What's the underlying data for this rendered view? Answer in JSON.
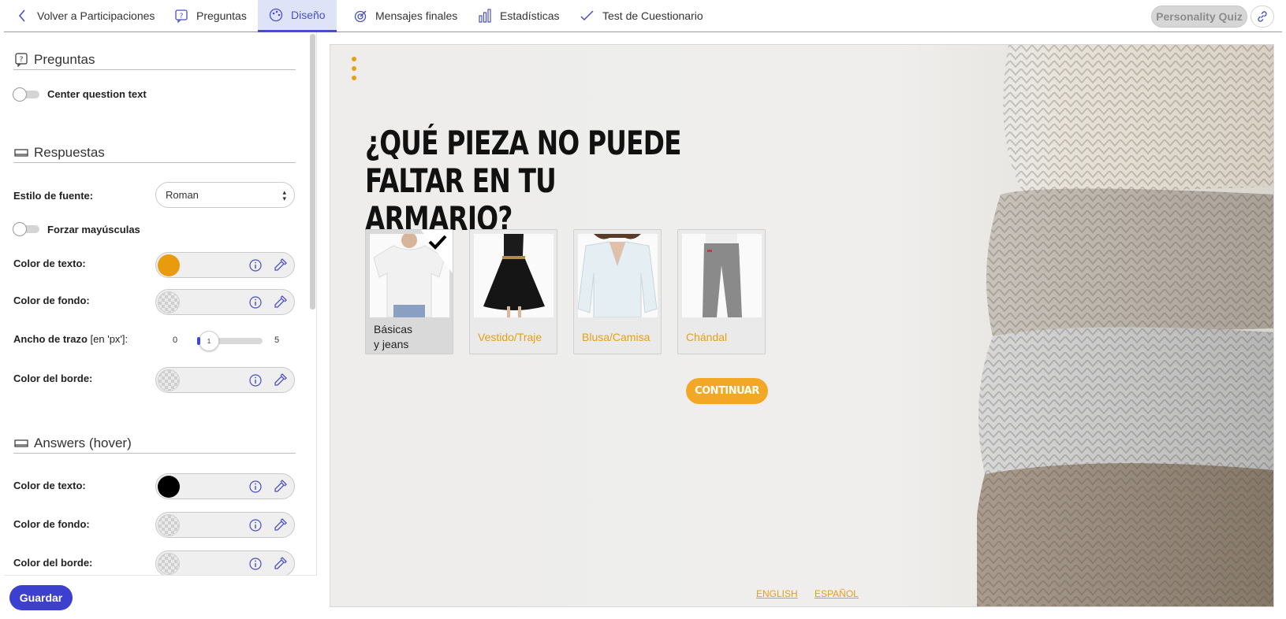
{
  "nav": {
    "back_label": "Volver a Participaciones",
    "tabs": [
      {
        "label": "Preguntas"
      },
      {
        "label": "Diseño"
      },
      {
        "label": "Mensajes finales"
      },
      {
        "label": "Estadísticas"
      },
      {
        "label": "Test de Cuestionario"
      }
    ],
    "active_tab": "Diseño",
    "quiz_type_badge": "Personality Quiz",
    "accent_color": "#4a4fc0"
  },
  "sidebar": {
    "preguntas": {
      "title": "Preguntas",
      "center_question_text_label": "Center question text"
    },
    "respuestas": {
      "title": "Respuestas",
      "font_style_label": "Estilo de fuente:",
      "font_style_value": "Roman",
      "force_uppercase_label": "Forzar mayúsculas",
      "text_color_label": "Color de texto:",
      "text_color": "#e89b0c",
      "bg_color_label": "Color de fondo:",
      "stroke_width_label": "Ancho de trazo",
      "stroke_width_unit": "[en 'px']:",
      "stroke_min": "0",
      "stroke_max": "5",
      "stroke_value": "1",
      "border_color_label": "Color del borde:"
    },
    "answers_hover": {
      "title": "Answers (hover)",
      "text_color_label": "Color de texto:",
      "text_color": "#000000",
      "bg_color_label": "Color de fondo:",
      "border_color_label": "Color del borde:"
    },
    "save_label": "Guardar"
  },
  "preview": {
    "question": "¿Qué pieza no puede faltar en tu armario?",
    "answers": [
      {
        "label": "Básicas\ny jeans",
        "selected": true,
        "image": "white-tshirt"
      },
      {
        "label": "Vestido/Traje",
        "selected": false,
        "image": "black-dress"
      },
      {
        "label": "Blusa/Camisa",
        "selected": false,
        "image": "white-blouse"
      },
      {
        "label": "Chándal",
        "selected": false,
        "image": "grey-sweatpants"
      }
    ],
    "continue_label": "CONTINUAR",
    "languages": [
      "ENGLISH",
      "ESPAÑOL"
    ],
    "accent_color": "#f2a825"
  }
}
